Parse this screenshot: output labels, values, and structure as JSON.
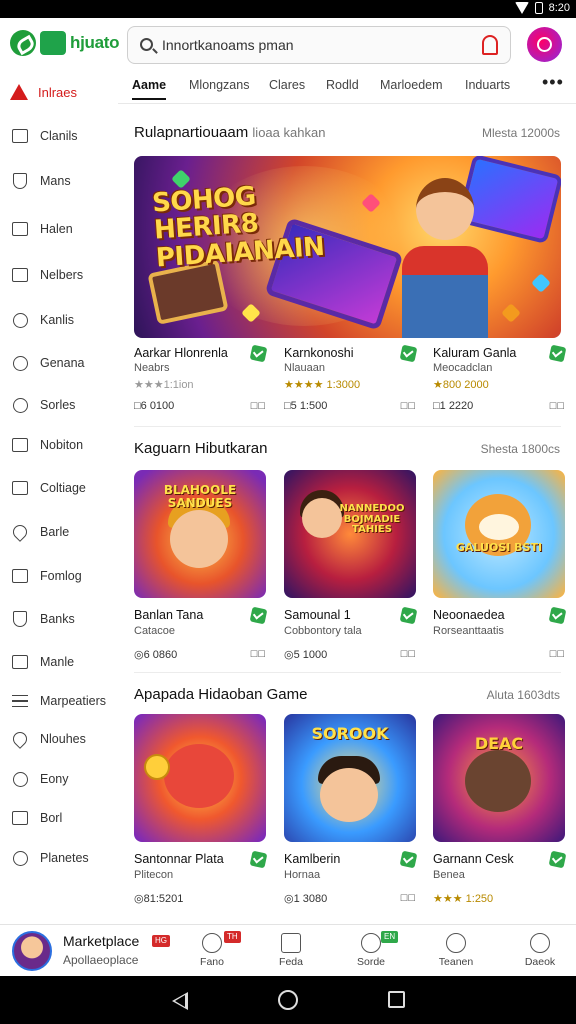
{
  "status_bar": {
    "time": "8:20"
  },
  "app": {
    "logo_text": "hjuato"
  },
  "search": {
    "placeholder": "Innortkanoams pman"
  },
  "sidebar": {
    "header": "Inlraes",
    "items": [
      {
        "label": "Clanils",
        "icon": "grid-icon"
      },
      {
        "label": "Mans",
        "icon": "shield-icon"
      },
      {
        "label": "Halen",
        "icon": "book-icon"
      },
      {
        "label": "Nelbers",
        "icon": "list-icon"
      },
      {
        "label": "Kanlis",
        "icon": "clock-icon"
      },
      {
        "label": "Genana",
        "icon": "heart-icon"
      },
      {
        "label": "Sorles",
        "icon": "check-circle-icon"
      },
      {
        "label": "Nobiton",
        "icon": "calendar-icon"
      },
      {
        "label": "Coltiage",
        "icon": "chart-icon"
      },
      {
        "label": "Barle",
        "icon": "tag-icon"
      },
      {
        "label": "Fomlog",
        "icon": "folder-icon"
      },
      {
        "label": "Banks",
        "icon": "bank-icon"
      },
      {
        "label": "Manle",
        "icon": "image-icon"
      },
      {
        "label": "Marpeatiers",
        "icon": "menu-icon"
      },
      {
        "label": "Nlouhes",
        "icon": "map-icon"
      },
      {
        "label": "Eony",
        "icon": "pin-icon"
      },
      {
        "label": "Borl",
        "icon": "cube-icon"
      },
      {
        "label": "Planetes",
        "icon": "globe-icon"
      }
    ]
  },
  "tabs": [
    "Aame",
    "Mlongzans",
    "Clares",
    "Rodld",
    "Marloedem",
    "Induarts"
  ],
  "sections": [
    {
      "title": "Rulapnartiouaam",
      "subtitle": "lioaa kahkan",
      "more": "Mlesta 12000s",
      "banner_title": "SOHOG HERIR8 PIDAIANAIN",
      "cards": [
        {
          "name": "Aarkar Hlonrenla",
          "sub": "Neabrs",
          "meta": "★★★1:1ion",
          "icons": "□6  0100"
        },
        {
          "name": "Karnkonoshi",
          "sub": "Nlauaan",
          "meta": "★★★★ 1:3000",
          "icons": "□5  1:500"
        },
        {
          "name": "Kaluram Ganla",
          "sub": "Meocadclan",
          "meta": "★800  2000",
          "icons": "□1  2220"
        }
      ]
    },
    {
      "title": "Kaguarn Hibutkaran",
      "more": "Shesta 1800cs",
      "cards": [
        {
          "name": "Banlan Tana",
          "sub": "Catacoe",
          "meta": "◎6  0860",
          "thumb_text": "BLAHOOLE SANDUES"
        },
        {
          "name": "Samounal 1",
          "sub": "Cobbontory tala",
          "meta": "◎5  1000",
          "thumb_text": "NANNEDOO BOJMADIE TAHIES"
        },
        {
          "name": "Neoonaedea",
          "sub": "Rorseanttaatis",
          "meta": "",
          "thumb_text": "GALUOSI BSTI"
        }
      ]
    },
    {
      "title": "Apapada Hidaoban Game",
      "more": "Aluta 1603dts",
      "cards": [
        {
          "name": "Santonnar Plata",
          "sub": "Plitecon",
          "meta": "◎81:5201",
          "thumb_text": ""
        },
        {
          "name": "Kamlberin",
          "sub": "Hornaa",
          "meta": "◎1  3080",
          "thumb_text": "SOROOK"
        },
        {
          "name": "Garnann Cesk",
          "sub": "Benea",
          "meta": "★★★  1:250",
          "thumb_text": "DEAC"
        }
      ]
    }
  ],
  "bottom_nav": {
    "title": "Marketplace",
    "title_badge": "HG",
    "subtitle": "Apollaeoplace",
    "items": [
      {
        "label": "Fano",
        "badge": "TH"
      },
      {
        "label": "Feda",
        "badge": ""
      },
      {
        "label": "Sorde",
        "badge": "EN"
      },
      {
        "label": "Teanen",
        "badge": ""
      },
      {
        "label": "Daeok",
        "badge": ""
      }
    ]
  },
  "colors": {
    "brand": "#1f9d3a",
    "alert": "#d41c1c",
    "verified": "#2fa84a"
  }
}
